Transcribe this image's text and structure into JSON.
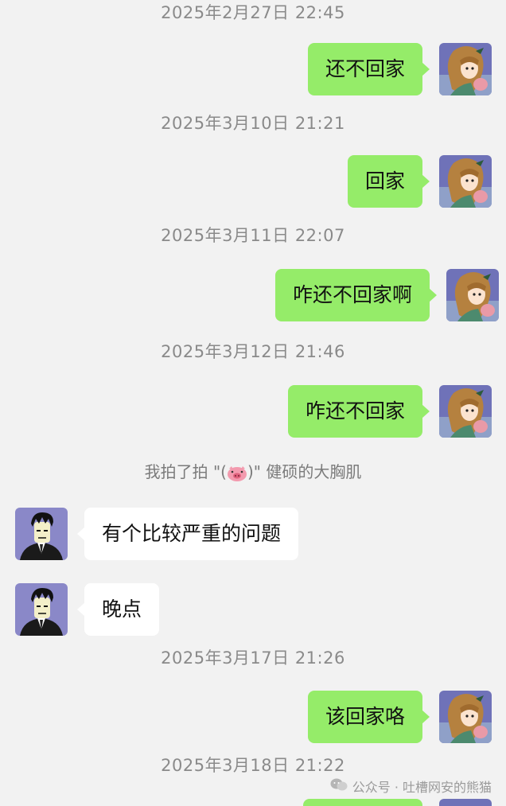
{
  "chat": {
    "timestamps": [
      "2025年2月27日 22:45",
      "2025年3月10日 21:21",
      "2025年3月11日 22:07",
      "2025年3月12日 21:46",
      "2025年3月17日 21:26",
      "2025年3月18日 21:22"
    ],
    "messages": [
      {
        "sender": "me",
        "text": "还不回家"
      },
      {
        "sender": "me",
        "text": "回家"
      },
      {
        "sender": "me",
        "text": "咋还不回家啊"
      },
      {
        "sender": "me",
        "text": "咋还不回家"
      },
      {
        "sender": "other",
        "text": "有个比较严重的问题"
      },
      {
        "sender": "other",
        "text": "晚点"
      },
      {
        "sender": "me",
        "text": "该回家咯"
      }
    ],
    "system_notice": {
      "prefix": "我拍了拍 \"(",
      "middle": ")\"",
      "suffix": " 健硕的大胸肌"
    }
  },
  "watermark": {
    "text": "公众号 · 吐槽网安的熊猫"
  },
  "colors": {
    "background": "#f2f2f2",
    "my_bubble": "#95ec69",
    "other_bubble": "#ffffff",
    "timestamp": "#8a8a8a"
  },
  "icons": {
    "my_avatar": "anime-girl-avatar",
    "other_avatar": "anime-man-suit-avatar",
    "pig": "pig-face-emoji",
    "watermark": "wechat-official-account-icon"
  }
}
